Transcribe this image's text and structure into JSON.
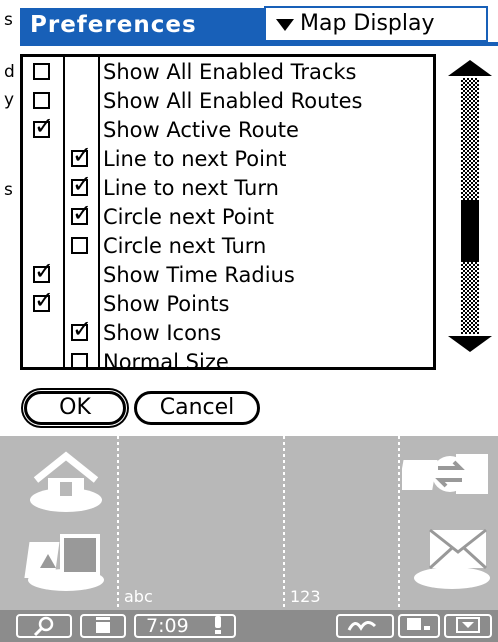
{
  "bleed_text": [
    "s",
    "d",
    "y",
    "s"
  ],
  "header": {
    "title": "Preferences",
    "popup_value": "Map Display"
  },
  "rows": [
    {
      "text": "Show All Enabled Tracks",
      "col": 1,
      "checked": false
    },
    {
      "text": "Show All Enabled Routes",
      "col": 1,
      "checked": false
    },
    {
      "text": "Show Active Route",
      "col": 1,
      "checked": true
    },
    {
      "text": "Line to next Point",
      "col": 2,
      "checked": true
    },
    {
      "text": "Line to next Turn",
      "col": 2,
      "checked": true
    },
    {
      "text": "Circle next Point",
      "col": 2,
      "checked": true
    },
    {
      "text": "Circle next Turn",
      "col": 2,
      "checked": false
    },
    {
      "text": "Show Time Radius",
      "col": 1,
      "checked": true
    },
    {
      "text": "Show Points",
      "col": 1,
      "checked": true
    },
    {
      "text": "Show Icons",
      "col": 2,
      "checked": true
    },
    {
      "text": "  Normal Size",
      "col": 2,
      "checked": false
    }
  ],
  "buttons": {
    "ok": "OK",
    "cancel": "Cancel"
  },
  "silk": {
    "abc": "abc",
    "num": "123"
  },
  "taskbar": {
    "time": "7:09"
  }
}
